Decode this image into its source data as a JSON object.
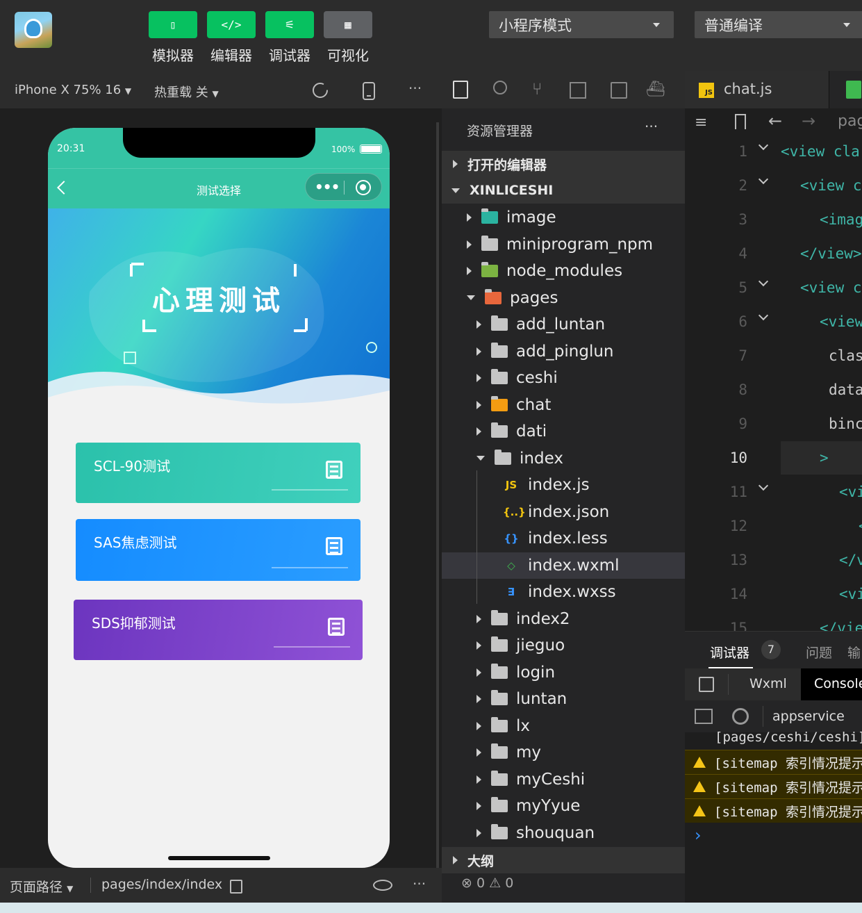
{
  "toolbar": {
    "buttons": [
      {
        "label": "模拟器",
        "glyph": "▯"
      },
      {
        "label": "编辑器",
        "glyph": "</>"
      },
      {
        "label": "调试器",
        "glyph": "⚟"
      },
      {
        "label": "可视化",
        "glyph": "▦"
      }
    ],
    "mode_select": "小程序模式",
    "compile_select": "普通编译"
  },
  "simulator": {
    "device": "iPhone X 75% 16",
    "hot_reload": "热重载 关",
    "status_time": "20:31",
    "battery": "100%",
    "page_title": "测试选择",
    "banner_title": "心理测试",
    "cards": [
      {
        "label": "SCL-90测试",
        "color": "#2cc2ae"
      },
      {
        "label": "SAS焦虑测试",
        "color": "#1a8cff"
      },
      {
        "label": "SDS抑郁测试",
        "color": "#7b3fc4"
      }
    ],
    "footer_path_label": "页面路径",
    "footer_path": "pages/index/index"
  },
  "explorer": {
    "title": "资源管理器",
    "more": "···",
    "open_editors": "打开的编辑器",
    "project": "XINLICESHI",
    "outline": "大纲",
    "errors": "0",
    "warnings": "0",
    "items": [
      {
        "name": "image",
        "level": 1,
        "type": "folder"
      },
      {
        "name": "miniprogram_npm",
        "level": 1,
        "type": "folder"
      },
      {
        "name": "node_modules",
        "level": 1,
        "type": "folder"
      },
      {
        "name": "pages",
        "level": 1,
        "type": "folder-open"
      },
      {
        "name": "add_luntan",
        "level": 2,
        "type": "folder"
      },
      {
        "name": "add_pinglun",
        "level": 2,
        "type": "folder"
      },
      {
        "name": "ceshi",
        "level": 2,
        "type": "folder"
      },
      {
        "name": "chat",
        "level": 2,
        "type": "folder"
      },
      {
        "name": "dati",
        "level": 2,
        "type": "folder"
      },
      {
        "name": "index",
        "level": 2,
        "type": "folder-open"
      },
      {
        "name": "index.js",
        "level": 3,
        "type": "js"
      },
      {
        "name": "index.json",
        "level": 3,
        "type": "json"
      },
      {
        "name": "index.less",
        "level": 3,
        "type": "less"
      },
      {
        "name": "index.wxml",
        "level": 3,
        "type": "wxml"
      },
      {
        "name": "index.wxss",
        "level": 3,
        "type": "wxss"
      },
      {
        "name": "index2",
        "level": 2,
        "type": "folder"
      },
      {
        "name": "jieguo",
        "level": 2,
        "type": "folder"
      },
      {
        "name": "login",
        "level": 2,
        "type": "folder"
      },
      {
        "name": "luntan",
        "level": 2,
        "type": "folder"
      },
      {
        "name": "lx",
        "level": 2,
        "type": "folder"
      },
      {
        "name": "my",
        "level": 2,
        "type": "folder"
      },
      {
        "name": "myCeshi",
        "level": 2,
        "type": "folder"
      },
      {
        "name": "myYyue",
        "level": 2,
        "type": "folder"
      },
      {
        "name": "shouquan",
        "level": 2,
        "type": "folder"
      }
    ]
  },
  "editor": {
    "tab": "chat.js",
    "breadcrumb": "pag",
    "lines": [
      {
        "no": "1",
        "code": "<view cla"
      },
      {
        "no": "2",
        "code": "<view c"
      },
      {
        "no": "3",
        "code": "<imag"
      },
      {
        "no": "4",
        "code": "</view>"
      },
      {
        "no": "5",
        "code": "<view c"
      },
      {
        "no": "6",
        "code": "<view"
      },
      {
        "no": "7",
        "code": "clas"
      },
      {
        "no": "8",
        "code": "data"
      },
      {
        "no": "9",
        "code": "binc"
      },
      {
        "no": "10",
        "code": ">"
      },
      {
        "no": "11",
        "code": "<vi"
      },
      {
        "no": "12",
        "code": "<"
      },
      {
        "no": "13",
        "code": "</v"
      },
      {
        "no": "14",
        "code": "<vi"
      },
      {
        "no": "15",
        "code": "</vie"
      }
    ]
  },
  "debugger": {
    "tab_debugger": "调试器",
    "badge": "7",
    "tab_problems": "问题",
    "tab_more": "输",
    "sub_wxml": "Wxml",
    "sub_console": "Console",
    "context": "appservice",
    "path_line": "[pages/ceshi/ceshi]",
    "warnings": [
      "[sitemap 索引情况提示",
      "[sitemap 索引情况提示",
      "[sitemap 索引情况提示"
    ],
    "prompt": "›"
  }
}
